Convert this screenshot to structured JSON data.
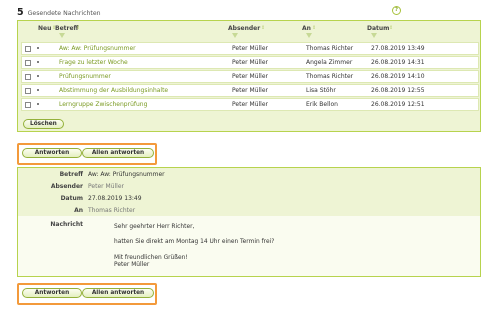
{
  "header": {
    "count": "5",
    "label": "Gesendete Nachrichten"
  },
  "help_icon": "question-circle-icon",
  "table": {
    "columns": {
      "new": "Neu",
      "subject": "Betreff",
      "sender": "Absender",
      "recipient": "An",
      "date": "Datum"
    },
    "rows": [
      {
        "subject": "Aw: Aw: Prüfungsnummer",
        "sender": "Peter Müller",
        "recipient": "Thomas Richter",
        "date": "27.08.2019 13:49"
      },
      {
        "subject": "Frage zu letzter Woche",
        "sender": "Peter Müller",
        "recipient": "Angela Zimmer",
        "date": "26.08.2019 14:31"
      },
      {
        "subject": "Prüfungsnummer",
        "sender": "Peter Müller",
        "recipient": "Thomas Richter",
        "date": "26.08.2019 14:10"
      },
      {
        "subject": "Abstimmung der Ausbildungsinhalte",
        "sender": "Peter Müller",
        "recipient": "Lisa Stöhr",
        "date": "26.08.2019 12:55"
      },
      {
        "subject": "Lerngruppe Zwischenprüfung",
        "sender": "Peter Müller",
        "recipient": "Erik Bellon",
        "date": "26.08.2019 12:51"
      }
    ],
    "delete_label": "Löschen"
  },
  "actions": {
    "reply": "Antworten",
    "reply_all": "Allen antworten"
  },
  "detail": {
    "subject_label": "Betreff",
    "subject": "Aw: Aw: Prüfungsnummer",
    "sender_label": "Absender",
    "sender": "Peter Müller",
    "date_label": "Datum",
    "date": "27.08.2019 13:49",
    "to_label": "An",
    "to": "Thomas Richter",
    "message_label": "Nachricht",
    "message_lines": [
      "Sehr geehrter Herr Richter,",
      "hatten Sie direkt am Montag 14 Uhr einen Termin frei?",
      "Mit freundlichen Grüßen!",
      "Peter Müller"
    ]
  },
  "colors": {
    "accent": "#b7d34e",
    "highlight": "#f39a3b",
    "link": "#7a9a22"
  }
}
